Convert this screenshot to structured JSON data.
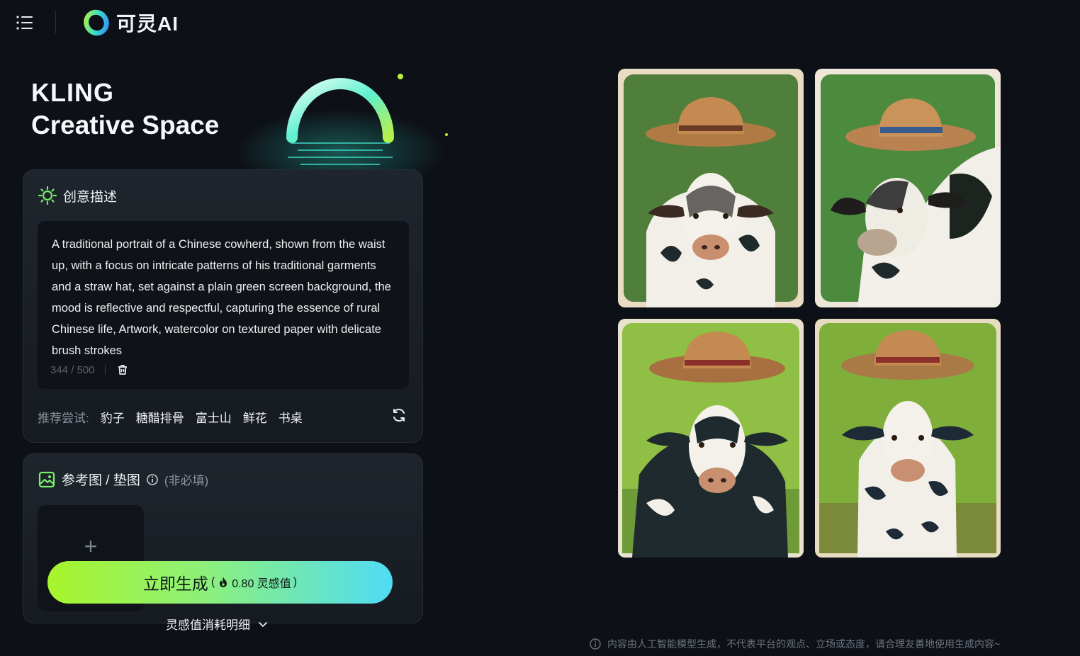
{
  "header": {
    "brand": "可灵AI",
    "menu_icon": "hamburger-menu-icon"
  },
  "hero": {
    "title_line1": "KLING",
    "title_line2": "Creative Space"
  },
  "prompt_card": {
    "title": "创意描述",
    "icon": "sparkle-sun-icon",
    "prompt_text": "A traditional portrait of a Chinese cowherd, shown from the waist up, with a focus on intricate patterns of his traditional garments and a straw hat, set against a plain green screen background, the mood is reflective and respectful, capturing the essence of rural Chinese life, Artwork, watercolor on textured paper with delicate brush strokes",
    "char_count": "344 / 500",
    "suggest_label": "推荐尝试:",
    "suggestions": [
      "豹子",
      "糖醋排骨",
      "富士山",
      "鲜花",
      "书桌"
    ]
  },
  "reference_card": {
    "title": "参考图 / 垫图",
    "optional_hint": "(非必填)",
    "upload_plus": "+"
  },
  "generate": {
    "label": "立即生成",
    "cost_open": "(",
    "cost_value": "0.80 灵感值",
    "cost_close": ")"
  },
  "cost_detail": {
    "label": "灵感值消耗明细"
  },
  "disclaimer": "内容由人工智能模型生成，不代表平台的观点、立场或态度，请合理友善地使用生成内容~",
  "colors": {
    "background": "#0d1016",
    "accent_green": "#a7f52a",
    "accent_cyan": "#4fdcf5"
  }
}
